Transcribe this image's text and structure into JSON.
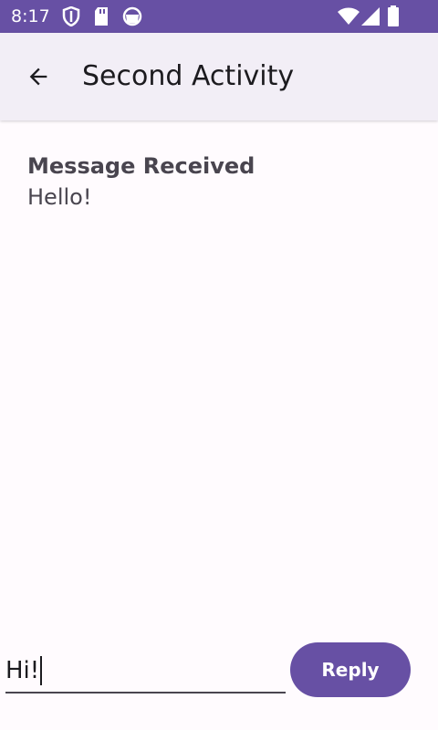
{
  "status_bar": {
    "time": "8:17",
    "icons": [
      "shield-icon",
      "sd-card-icon",
      "circle-app-icon",
      "wifi-icon",
      "cellular-signal-icon",
      "battery-icon"
    ],
    "background_color": "#6750a4"
  },
  "app_bar": {
    "title": "Second Activity",
    "back_icon": "arrow-back-icon",
    "background_color": "#f2eef6"
  },
  "message": {
    "heading": "Message Received",
    "text": "Hello!"
  },
  "reply": {
    "input_value": "Hi!",
    "button_label": "Reply",
    "accent_color": "#6750a4"
  }
}
